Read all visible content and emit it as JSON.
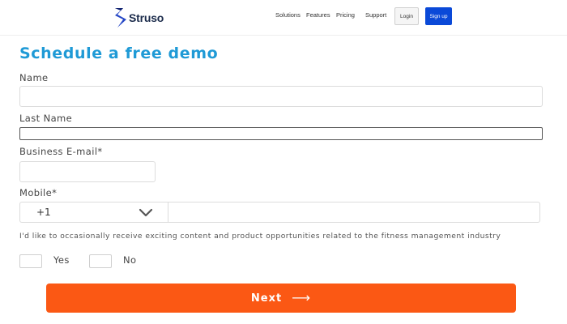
{
  "header": {
    "logo_text": "Struso",
    "logo_icon": "struso-s-logo",
    "nav": [
      "Solutions",
      "Features",
      "Pricing",
      "Support"
    ],
    "login_label": "Login",
    "signup_label": "Sign up",
    "signup_color": "#0a49d8"
  },
  "form": {
    "title": "Schedule a free demo",
    "title_color": "#1f9ad6",
    "name_label": "Name",
    "name_value": "",
    "last_name_label": "Last Name",
    "last_name_value": "",
    "email_label": "Business E-mail*",
    "email_value": "",
    "mobile_label": "Mobile*",
    "country_code": "+1",
    "country_dropdown_icon": "chevron-down-icon",
    "phone_value": "",
    "consent_text": "I'd like to occasionally receive exciting content and product opportunities related to the fitness management industry",
    "options": [
      {
        "label": "Yes",
        "checked": false
      },
      {
        "label": "No",
        "checked": false
      }
    ],
    "next_label": "Next",
    "next_icon": "arrow-right-icon",
    "next_color": "#fb5814"
  }
}
